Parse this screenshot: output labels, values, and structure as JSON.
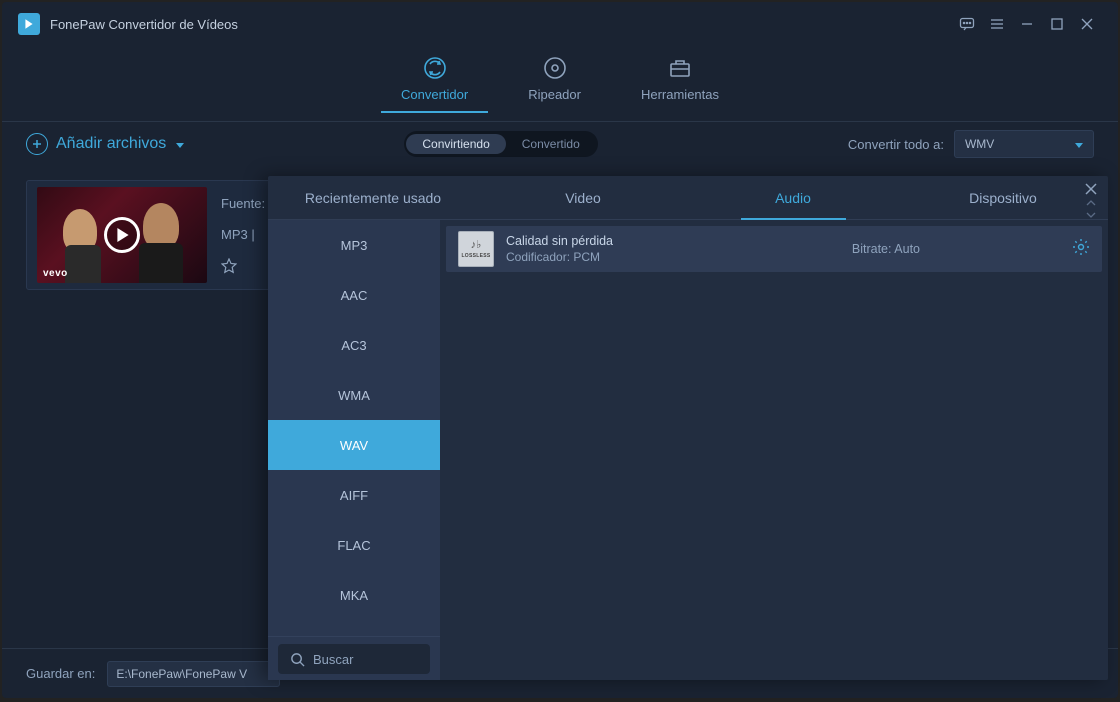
{
  "titlebar": {
    "title": "FonePaw Convertidor de Vídeos"
  },
  "mainTabs": {
    "convertidor": "Convertidor",
    "ripeador": "Ripeador",
    "herramientas": "Herramientas"
  },
  "toolbar": {
    "addFiles": "Añadir archivos",
    "segConverting": "Convirtiendo",
    "segConverted": "Convertido",
    "convertAllLabel": "Convertir todo a:",
    "convertAllValue": "WMV"
  },
  "item": {
    "sourceLabel": "Fuente:",
    "formatLine": "MP3 |",
    "vevo": "vevo"
  },
  "footer": {
    "saveLabel": "Guardar en:",
    "path": "E:\\FonePaw\\FonePaw V"
  },
  "panel": {
    "tabs": {
      "recent": "Recientemente usado",
      "video": "Video",
      "audio": "Audio",
      "device": "Dispositivo"
    },
    "formats": [
      "MP3",
      "AAC",
      "AC3",
      "WMA",
      "WAV",
      "AIFF",
      "FLAC",
      "MKA"
    ],
    "activeFormat": "WAV",
    "searchPlaceholder": "Buscar",
    "preset": {
      "title": "Calidad sin pérdida",
      "encoderLabel": "Codificador:",
      "encoderValue": "PCM",
      "bitrateLabel": "Bitrate:",
      "bitrateValue": "Auto",
      "iconText": "LOSSLESS"
    }
  }
}
